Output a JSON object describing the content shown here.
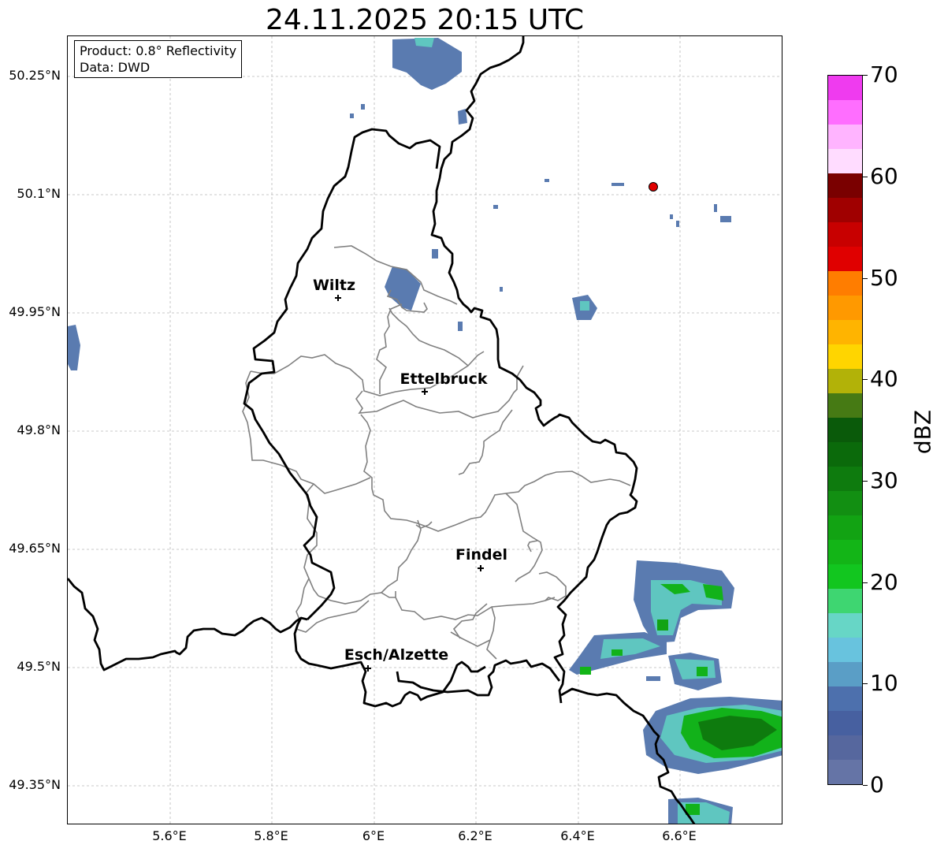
{
  "title": "24.11.2025 20:15 UTC",
  "info_box": {
    "product": "Product: 0.8° Reflectivity",
    "data": "Data: DWD"
  },
  "lat_ticks": [
    "50.25°N",
    "50.1°N",
    "49.95°N",
    "49.8°N",
    "49.65°N",
    "49.5°N",
    "49.35°N"
  ],
  "lon_ticks": [
    "5.6°E",
    "5.8°E",
    "6°E",
    "6.2°E",
    "6.4°E",
    "6.6°E"
  ],
  "cities": [
    {
      "name": "Wiltz"
    },
    {
      "name": "Ettelbruck"
    },
    {
      "name": "Findel"
    },
    {
      "name": "Esch/Alzette"
    }
  ],
  "radar_site_color": "#e00000",
  "colorbar": {
    "unit": "dBZ",
    "tick_labels": [
      "0",
      "10",
      "20",
      "30",
      "40",
      "50",
      "60",
      "70"
    ],
    "colors": [
      "#6574a6",
      "#56679e",
      "#4760a0",
      "#4d70ad",
      "#5a9ec6",
      "#68c3de",
      "#67d6c6",
      "#3ed671",
      "#12c61f",
      "#13b517",
      "#12a313",
      "#128f12",
      "#0e7b0e",
      "#0b6a0b",
      "#0a5a0a",
      "#467a14",
      "#b2b208",
      "#ffd500",
      "#ffb400",
      "#ff9900",
      "#ff7d00",
      "#e00000",
      "#c80000",
      "#a00000",
      "#7a0000",
      "#ffdcff",
      "#ffb4ff",
      "#ff6eff",
      "#ef3bef"
    ]
  }
}
